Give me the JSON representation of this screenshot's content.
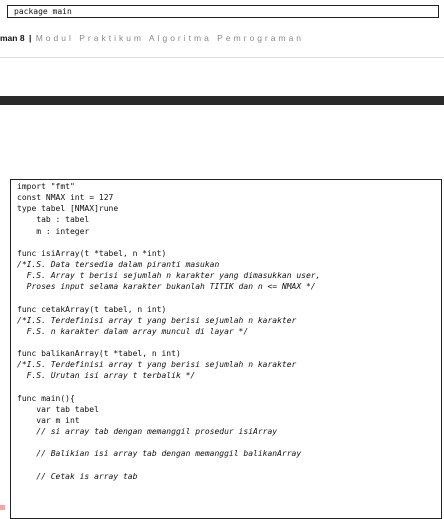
{
  "top_code": "package main",
  "header": {
    "page_number": "man 8",
    "separator": "|",
    "book_title": "Modul Praktikum Algoritma Pemrograman"
  },
  "code_lines": [
    {
      "text": "import \"fmt\"",
      "comment": false
    },
    {
      "text": "const NMAX int = 127",
      "comment": false
    },
    {
      "text": "type tabel [NMAX]rune",
      "comment": false
    },
    {
      "text": "    tab : tabel",
      "comment": false
    },
    {
      "text": "    m : integer",
      "comment": false
    },
    {
      "text": "",
      "comment": false
    },
    {
      "text": "func isiArray(t *tabel, n *int)",
      "comment": false
    },
    {
      "text": "/*I.S. Data tersedia dalam piranti masukan",
      "comment": true
    },
    {
      "text": "  F.S. Array t berisi sejumlah n karakter yang dimasukkan user,",
      "comment": true
    },
    {
      "text": "  Proses input selama karakter bukanlah TITIK dan n <= NMAX */",
      "comment": true
    },
    {
      "text": "",
      "comment": false
    },
    {
      "text": "func cetakArray(t tabel, n int)",
      "comment": false
    },
    {
      "text": "/*I.S. Terdefinisi array t yang berisi sejumlah n karakter",
      "comment": true
    },
    {
      "text": "  F.S. n karakter dalam array muncul di layar */",
      "comment": true
    },
    {
      "text": "",
      "comment": false
    },
    {
      "text": "func balikanArray(t *tabel, n int)",
      "comment": false
    },
    {
      "text": "/*I.S. Terdefinisi array t yang berisi sejumlah n karakter",
      "comment": true
    },
    {
      "text": "  F.S. Urutan isi array t terbalik */",
      "comment": true
    },
    {
      "text": "",
      "comment": false
    },
    {
      "text": "func main(){",
      "comment": false
    },
    {
      "text": "    var tab tabel",
      "comment": false
    },
    {
      "text": "    var m int",
      "comment": false
    },
    {
      "text": "    // si array tab dengan memanggil prosedur isiArray",
      "comment": true
    },
    {
      "text": "",
      "comment": false
    },
    {
      "text": "    // Balikian isi array tab dengan memanggil balikanArray",
      "comment": true
    },
    {
      "text": "",
      "comment": false
    },
    {
      "text": "    // Cetak is array tab",
      "comment": true
    }
  ]
}
